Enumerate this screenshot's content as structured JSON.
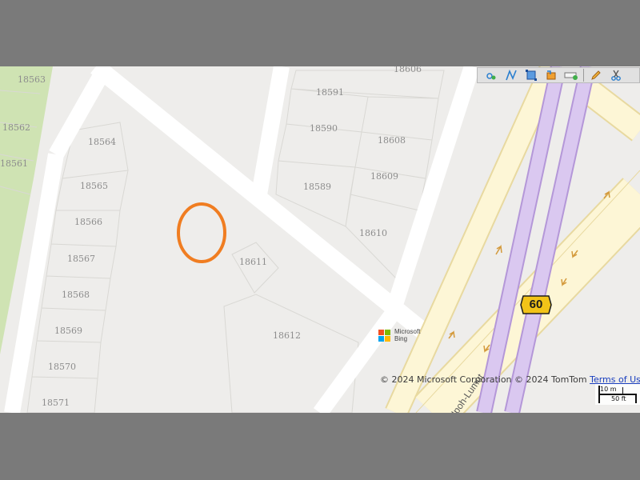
{
  "map": {
    "parcels": [
      {
        "id": "18563"
      },
      {
        "id": "18562"
      },
      {
        "id": "18561"
      },
      {
        "id": "18564"
      },
      {
        "id": "18565"
      },
      {
        "id": "18566"
      },
      {
        "id": "18567"
      },
      {
        "id": "18568"
      },
      {
        "id": "18569"
      },
      {
        "id": "18570"
      },
      {
        "id": "18571"
      },
      {
        "id": "18606"
      },
      {
        "id": "18591"
      },
      {
        "id": "18590"
      },
      {
        "id": "18608"
      },
      {
        "id": "18589"
      },
      {
        "id": "18609"
      },
      {
        "id": "18610"
      },
      {
        "id": "18611"
      },
      {
        "id": "18612"
      }
    ],
    "route_shield": "60",
    "road_name": "Ipoh-Lumut",
    "colors": {
      "land": "#eeedeb",
      "park": "#cfe3b3",
      "local_road": "#ffffff",
      "motorway": "#dac8f0",
      "motorway_casing": "#b497d8",
      "trunk": "#fdf6d6",
      "trunk_casing": "#e8d9a0",
      "marker_circle": "#f07d21",
      "shield": "#f2c318"
    }
  },
  "toolbar": {
    "tools": [
      {
        "icon": "zoom-to-point-icon"
      },
      {
        "icon": "measure-line-icon"
      },
      {
        "icon": "zoom-to-area-icon"
      },
      {
        "icon": "layers-icon"
      },
      {
        "icon": "toggle-view-icon"
      },
      {
        "icon": "edit-pencil-icon"
      },
      {
        "icon": "cut-scissors-icon"
      }
    ]
  },
  "attribution": {
    "bing_logo": "Microsoft Bing",
    "copyright_text": "© 2024 Microsoft Corporation © 2024 TomTom ",
    "terms_link": "Terms of Use"
  },
  "scale": {
    "metric": "10 m",
    "imperial": "50 ft"
  }
}
